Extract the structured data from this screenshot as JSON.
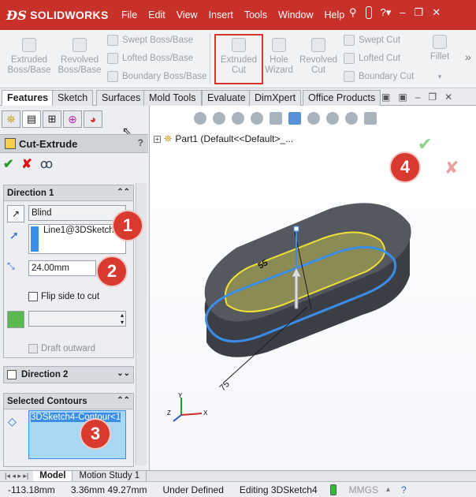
{
  "app": {
    "title": "SOLIDWORKS",
    "brand_color": "#c8312a"
  },
  "menu": {
    "items": [
      "File",
      "Edit",
      "View",
      "Insert",
      "Tools",
      "Window",
      "Help"
    ]
  },
  "ribbon": {
    "extruded_boss": "Extruded\nBoss/Base",
    "revolved_boss": "Revolved\nBoss/Base",
    "swept_boss": "Swept Boss/Base",
    "lofted_boss": "Lofted Boss/Base",
    "boundary_boss": "Boundary Boss/Base",
    "extruded_cut": "Extruded\nCut",
    "hole_wizard": "Hole\nWizard",
    "revolved_cut": "Revolved\nCut",
    "swept_cut": "Swept Cut",
    "lofted_cut": "Lofted Cut",
    "boundary_cut": "Boundary Cut",
    "fillet": "Fillet"
  },
  "tabs": [
    "Features",
    "Sketch",
    "Surfaces",
    "Mold Tools",
    "Evaluate",
    "DimXpert",
    "Office Products"
  ],
  "property_manager": {
    "title": "Cut-Extrude",
    "direction1": {
      "label": "Direction 1",
      "end_condition": "Blind",
      "direction_ref": "Line1@3DSketch2",
      "depth": "24.00mm",
      "flip_side": "Flip side to cut",
      "draft_outward": "Draft outward"
    },
    "direction2": {
      "label": "Direction 2"
    },
    "selected_contours": {
      "label": "Selected Contours",
      "item": "3DSketch4-Contour<1"
    }
  },
  "tree": {
    "part": "Part1  (Default<<Default>_..."
  },
  "callouts": [
    "1",
    "2",
    "3",
    "4"
  ],
  "model": {
    "dim1": "55",
    "dim2": "75"
  },
  "bottom_tabs": [
    "Model",
    "Motion Study 1"
  ],
  "status": {
    "x": "-113.18mm",
    "y": "3.36mm 49.27mm",
    "state": "Under Defined",
    "editing": "Editing 3DSketch4",
    "units": "MMGS"
  }
}
